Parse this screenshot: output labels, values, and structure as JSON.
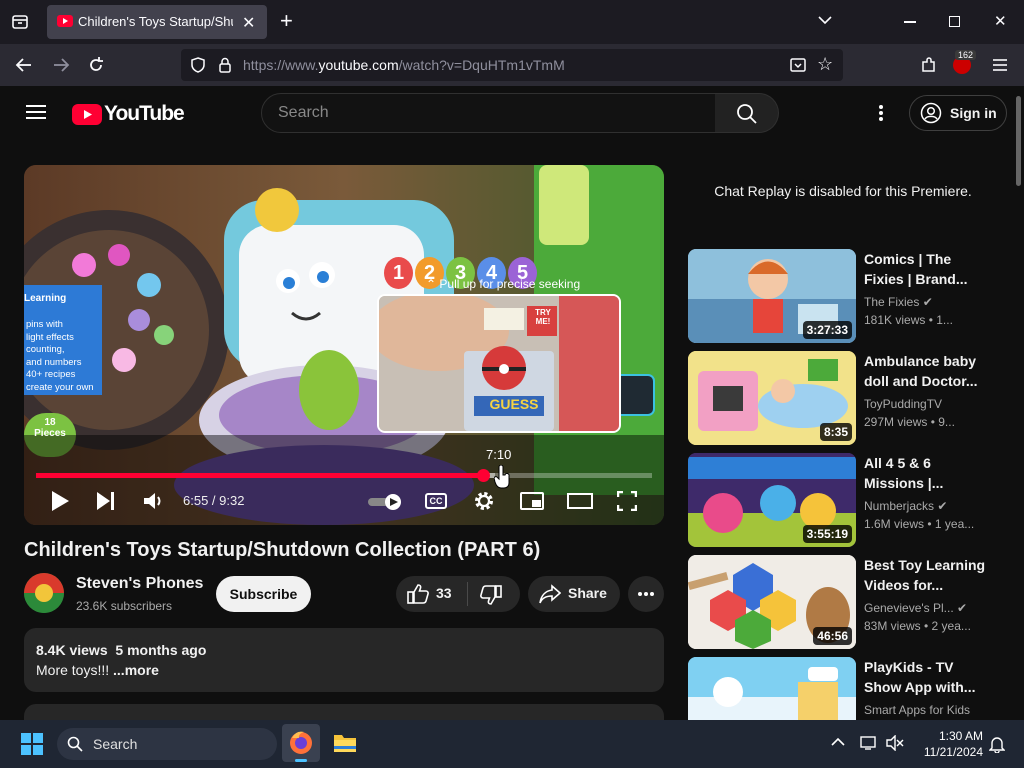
{
  "browser": {
    "tab_title": "Children's Toys Startup/Shutdo",
    "url_prefix": "https://www.",
    "url_domain": "youtube.com",
    "url_path": "/watch?v=DquHTm1vTmM",
    "extension_badge": "162"
  },
  "header": {
    "logo_text": "YouTube",
    "search_placeholder": "Search",
    "signin_label": "Sign in"
  },
  "player": {
    "seek_hint": "Pull up for precise seeking",
    "hover_time": "7:10",
    "time_display": "6:55 / 9:32",
    "progress_fraction": 0.7255,
    "cc_label": "CC",
    "toy_banner": "Learning",
    "toy_lines": [
      "pins with",
      "light effects",
      "counting,",
      "and numbers",
      "40+ recipes",
      "create your own"
    ],
    "toy_badge": "18 Pieces",
    "toy_numbers": [
      "1",
      "2",
      "3",
      "4",
      "5"
    ],
    "preview_box_label": "GUESS",
    "preview_try": "TRY ME!"
  },
  "video": {
    "title": "Children's Toys Startup/Shutdown Collection (PART 6)",
    "channel_name": "Steven's Phones",
    "subscribers": "23.6K subscribers",
    "subscribe_label": "Subscribe",
    "likes": "33",
    "share_label": "Share",
    "views": "8.4K views",
    "age": "5 months ago",
    "description": "More toys!!!",
    "more_label": "...more"
  },
  "sidebar": {
    "chat_notice": "Chat Replay is disabled for this Premiere.",
    "recommendations": [
      {
        "title1": "Comics | The",
        "title2": "Fixies | Brand...",
        "channel": "The Fixies",
        "verified": true,
        "meta": "181K views  • 1...",
        "duration": "3:27:33",
        "color": "#7fb4d6"
      },
      {
        "title1": "Ambulance baby",
        "title2": "doll and Doctor...",
        "channel": "ToyPuddingTV",
        "verified": false,
        "meta": "297M views  • 9...",
        "duration": "8:35",
        "color": "#e8d25a"
      },
      {
        "title1": "All 4 5 & 6",
        "title2": "Missions |...",
        "channel": "Numberjacks",
        "verified": true,
        "meta": "1.6M views  • 1 yea...",
        "duration": "3:55:19",
        "color": "#5a2c7a"
      },
      {
        "title1": "Best Toy Learning",
        "title2": "Videos for...",
        "channel": "Genevieve's Pl...",
        "verified": true,
        "meta": "83M views  • 2 yea...",
        "duration": "46:56",
        "color": "#f3f3f3"
      },
      {
        "title1": "PlayKids - TV",
        "title2": "Show App with...",
        "channel": "Smart Apps for Kids",
        "verified": false,
        "meta": "",
        "duration": "",
        "color": "#6cc3ef"
      }
    ]
  },
  "taskbar": {
    "search_label": "Search",
    "time": "1:30 AM",
    "date": "11/21/2024"
  },
  "colors": {
    "accent": "#ff0033",
    "background": "#0f0f0f",
    "chip": "#272727",
    "muted_text": "#aaaaaa"
  }
}
